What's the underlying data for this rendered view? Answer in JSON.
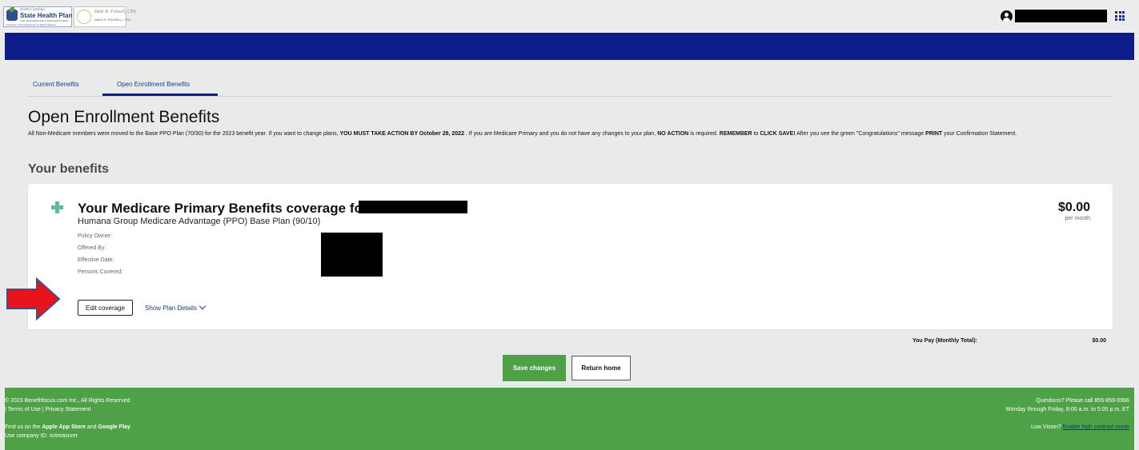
{
  "header": {
    "logo_line1": "North Carolina",
    "logo_name": "State Health Plan",
    "logo_tagline": "FOR TEACHERS AND STATE EMPLOYEES",
    "logo_subtitle": "A Division of the Department of State Treasurer",
    "treasurer_signature": "Dale R. Folwell, CPA",
    "treasurer_caption": "DALE R. FOLWELL, CPA"
  },
  "tabs": [
    {
      "label": "Current Benefits",
      "active": false
    },
    {
      "label": "Open Enrollment Benefits",
      "active": true
    }
  ],
  "page_title": "Open Enrollment Benefits",
  "notice": {
    "t1": "All Non-Medicare members were moved to the Base PPO Plan (70/30) for the 2023 benefit year. If you want to change plans, ",
    "b1": "YOU MUST TAKE ACTION BY October 28, 2022",
    "t2": " . If you are Medicare Primary and you do not have any changes to your plan, ",
    "b2": "NO ACTION",
    "t3": " is required. ",
    "b3": "REMEMBER",
    "t4": " to ",
    "b4": "CLICK SAVE!",
    "t5": " After you see the green \"Congratulations\" message ",
    "b5": "PRINT",
    "t6": " your Confirmation Statement."
  },
  "section_title": "Your benefits",
  "coverage": {
    "title": "Your Medicare Primary Benefits coverage for",
    "plan_name": "Humana Group Medicare Advantage (PPO) Base Plan (90/10)",
    "price": "$0.00",
    "price_period": "per month",
    "details": {
      "policy_owner": "Policy Owner:",
      "offered_by": "Offered By:",
      "effective_date": "Effective Date:",
      "persons_covered": "Persons Covered:"
    },
    "edit_label": "Edit coverage",
    "show_details_label": "Show Plan Details"
  },
  "totals": {
    "label": "You Pay (Monthly Total):",
    "value": "$0.00"
  },
  "actions": {
    "save_label": "Save changes",
    "home_label": "Return home"
  },
  "footer": {
    "copyright": "© 2023 Benefitfocus.com Inc., All Rights Reserved",
    "sep": "| ",
    "terms": "Terms of Use",
    "sep2": " | ",
    "privacy": "Privacy Statement",
    "find_us_pre": "Find us on the ",
    "app_store": "Apple App Store",
    "and": " and ",
    "google_play": "Google Play",
    "company_id": "Use company ID: nctreasurer",
    "questions": "Questions? Please call 855-859-0966",
    "hours": "Monday through Friday, 8:00 a.m. to 5:00 p.m. ET",
    "low_vision": "Low Vision? ",
    "contrast_link": "Enable high contrast mode"
  },
  "colors": {
    "nav_blue": "#0e1c8b",
    "footer_green": "#4ea146",
    "save_green": "#4ea146",
    "arrow_red": "#e8141b",
    "plus_teal": "#5bbf8f"
  },
  "icons": [
    "user-icon",
    "apps-grid-icon",
    "plus-icon",
    "chevron-down-icon",
    "red-arrow-icon"
  ]
}
